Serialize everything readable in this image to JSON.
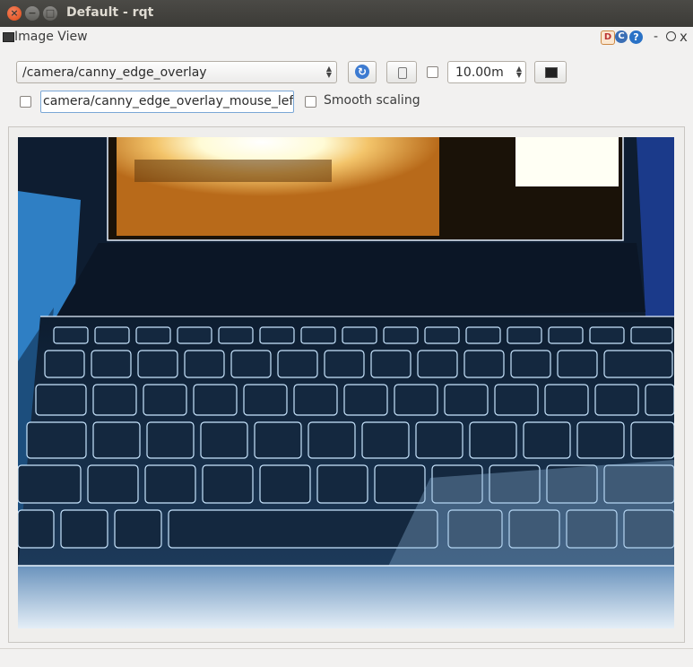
{
  "window": {
    "title": "Default - rqt"
  },
  "dock": {
    "title": "Image View",
    "d_label": "D",
    "c_label": "C",
    "help_label": "?",
    "dash_label": "-",
    "close_label": "x"
  },
  "toolbar": {
    "topic_value": "/camera/canny_edge_overlay",
    "zoom_value": "10.00m",
    "mouse_topic_value": "camera/canny_edge_overlay_mouse_left",
    "smooth_scaling_label": "Smooth scaling",
    "refresh_glyph": "↻"
  },
  "image_view": {
    "description_icon": "camera-frame-image",
    "accent": "#3d7bd1"
  }
}
